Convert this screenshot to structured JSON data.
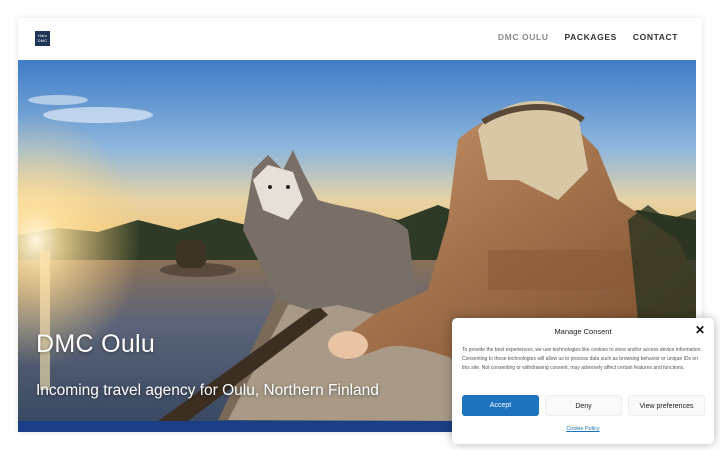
{
  "header": {
    "logo_lines": [
      "Halo",
      "DMC"
    ],
    "nav": [
      {
        "label": "DMC OULU",
        "active": true
      },
      {
        "label": "PACKAGES",
        "active": false
      },
      {
        "label": "CONTACT",
        "active": false
      }
    ]
  },
  "hero": {
    "title": "DMC Oulu",
    "subtitle": "Incoming travel agency for Oulu, Northern Finland",
    "image": "lake scene with husky dog on wooden boat and woman in fur-trimmed leather jacket at sunset"
  },
  "consent": {
    "title": "Manage Consent",
    "text": "To provide the best experiences, we use technologies like cookies to store and/or access device information. Consenting to these technologies will allow us to process data such as browsing behavior or unique IDs on this site. Not consenting or withdrawing consent, may adversely affect certain features and functions.",
    "accept": "Accept",
    "deny": "Deny",
    "preferences": "View preferences",
    "policy_link": "Cookie Policy"
  },
  "colors": {
    "brand_blue": "#1b3f86",
    "accept_button": "#1e73be",
    "logo_bg": "#1e3558"
  }
}
